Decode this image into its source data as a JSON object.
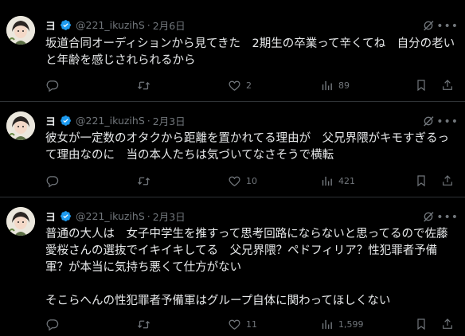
{
  "tweets": [
    {
      "author_name": "ヨ",
      "handle": "@221_ikuzihS",
      "separator": "·",
      "date": "2月6日",
      "text": "坂道合同オーディションから見てきた　2期生の卒業って辛くてね　自分の老いと年齢を感じされられるから",
      "replies": "",
      "retweets": "",
      "likes": "2",
      "views": "89"
    },
    {
      "author_name": "ヨ",
      "handle": "@221_ikuzihS",
      "separator": "·",
      "date": "2月3日",
      "text": "彼女が一定数のオタクから距離を置かれてる理由が　父兄界隈がキモすぎるって理由なのに　当の本人たちは気づいてなさそうで横転",
      "replies": "",
      "retweets": "",
      "likes": "10",
      "views": "421"
    },
    {
      "author_name": "ヨ",
      "handle": "@221_ikuzihS",
      "separator": "·",
      "date": "2月3日",
      "text": "普通の大人は　女子中学生を推すって思考回路にならないと思ってるので佐藤愛桜さんの選抜でイキイキしてる　父兄界隈？ペドフィリア？性犯罪者予備軍？が本当に気持ち悪くて仕方がない\n\nそこらへんの性犯罪者予備軍はグループ自体に関わってほしくない",
      "replies": "",
      "retweets": "",
      "likes": "11",
      "views": "1,599"
    }
  ],
  "icons": {
    "verified": "verified-badge-icon",
    "grok": "grok-icon",
    "more": "more-icon",
    "reply": "reply-icon",
    "retweet": "retweet-icon",
    "like": "heart-icon",
    "views": "views-icon",
    "bookmark": "bookmark-icon",
    "share": "share-icon"
  },
  "colors": {
    "background": "#000000",
    "text": "#e7e9ea",
    "muted": "#71767b",
    "divider": "#2f3336",
    "verified": "#1d9bf0"
  }
}
